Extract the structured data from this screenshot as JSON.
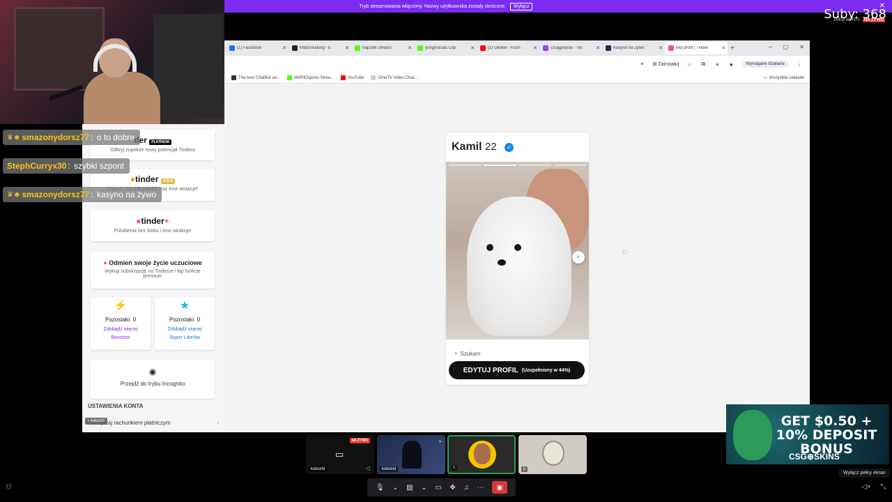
{
  "banner": {
    "text": "Tryb streamowania włączony. Nazwy użytkownika zostały skrócone.",
    "button": "Wyłącz"
  },
  "overlay": {
    "subs": "Suby: 368",
    "fps": "1440p 60 FPS",
    "live": "NA ŻYWO"
  },
  "browser": {
    "tabs": [
      {
        "label": "(1) Facebook",
        "color": "#1877f2"
      },
      {
        "label": "Matchmaking - E",
        "color": "#222222"
      },
      {
        "label": "trapuflik Stream",
        "color": "#53fc18"
      },
      {
        "label": "yungmacias Clip",
        "color": "#53fc18"
      },
      {
        "label": "(2) Okekel - Koch",
        "color": "#ff0000"
      },
      {
        "label": "Osiągnięcia - Twi",
        "color": "#9146ff"
      },
      {
        "label": "Kasyno na Żywo",
        "color": "#1c2a5a"
      },
      {
        "label": "Mój profil | Tinder",
        "color": "#fd5068"
      }
    ],
    "new_tab": "+",
    "window_controls": [
      "–",
      "▢",
      "✕"
    ],
    "install_label": "Zainstaluj",
    "action_required": "Wymagane działanie",
    "bookmarks": [
      {
        "label": "The best ChatBot an...",
        "color": "#333333"
      },
      {
        "label": "MARIOspzoo Strea...",
        "color": "#53fc18"
      },
      {
        "label": "YouTube",
        "color": "#ff0000"
      },
      {
        "label": "OmeTV Video Chat...",
        "color": "#cccccc"
      }
    ],
    "all_bookmarks": "Wszystkie zakładki"
  },
  "sidebar": {
    "platinum_logo": "der",
    "platinum_badge": "PLATINUM",
    "platinum_sub": "Odkryj zupełnie nowy potencjał Tindera",
    "gold_logo": "tinder",
    "gold_badge": "GOLD",
    "gold_sub": "Zobacz, kto Cię polubił oraz inne atrakcje!",
    "plus_logo": "tinder",
    "plus_mark": "+",
    "plus_sub": "Polubienia bez limitu i inne atrakcje!",
    "change_title": "Odmień swoje życie uczuciowe",
    "change_sub": "Wykup subskrypcję na Tinderze i łap funkcje premium",
    "boost_label": "Pozostało: 0",
    "boost_link": "Zdobądź więcej Boostów",
    "superlike_label": "Pozostało: 0",
    "superlike_link": "Zdobądź więcej Super Like'ów",
    "incognito_label": "Przejdź do trybu Incognito",
    "settings_heading": "USTAWIENIA KONTA",
    "payment_row": "Zarządzaj rachunkiem płatniczym",
    "host_tag": "kokoshi"
  },
  "chat": [
    {
      "user": "smazonydorsz77",
      "msg": "o to dobre",
      "crown": true
    },
    {
      "user": "StephCurryx30",
      "msg": "szybki szpont",
      "crown": false
    },
    {
      "user": "smazonydorsz77",
      "msg": "kasyno na żywo",
      "crown": true
    }
  ],
  "profile": {
    "name": "Kamil",
    "age": "22",
    "seeking": "Szukam",
    "edit_button": "EDYTUJ PROFIL",
    "completion": "(Uzupełniony w 44%)"
  },
  "ad": {
    "headline": "GET $0.50 + 10% DEPOSIT BONUS",
    "brand": "CSG⊕SKINS"
  },
  "participants": [
    {
      "name": "kokoshi",
      "bg": "#111111",
      "live": true
    },
    {
      "name": "kokoshi",
      "bg": "#1e2a4a",
      "live": false
    },
    {
      "name": "t",
      "bg": "#2a2a2a",
      "live": false
    },
    {
      "name": "p",
      "bg": "#c8c4bc",
      "live": false
    }
  ],
  "toolbar": {
    "fullscreen_tip": "Wyłącz pełny ekran"
  }
}
